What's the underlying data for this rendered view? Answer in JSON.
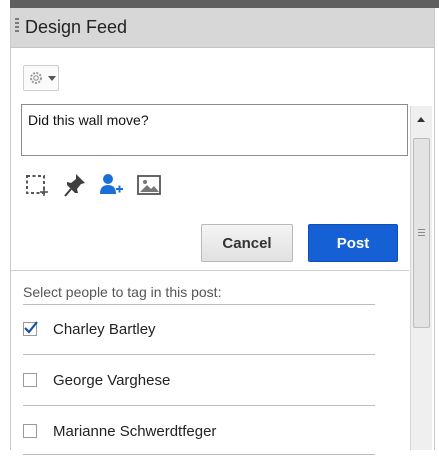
{
  "panel": {
    "title": "Design Feed"
  },
  "toolbar": {
    "settings_icon": "gear-icon",
    "dropdown_icon": "chevron-down-icon"
  },
  "composer": {
    "text": "Did this wall move?",
    "icons": [
      "region-select-icon",
      "pin-icon",
      "tag-person-icon",
      "image-icon"
    ],
    "active_icon_color": "#1a6fd8"
  },
  "actions": {
    "cancel_label": "Cancel",
    "post_label": "Post",
    "post_color": "#1460d4"
  },
  "tagging": {
    "prompt": "Select people to tag in this post:",
    "people": [
      {
        "name": "Charley Bartley",
        "checked": true
      },
      {
        "name": "George Varghese",
        "checked": false
      },
      {
        "name": "Marianne Schwerdtfeger",
        "checked": false
      }
    ]
  }
}
